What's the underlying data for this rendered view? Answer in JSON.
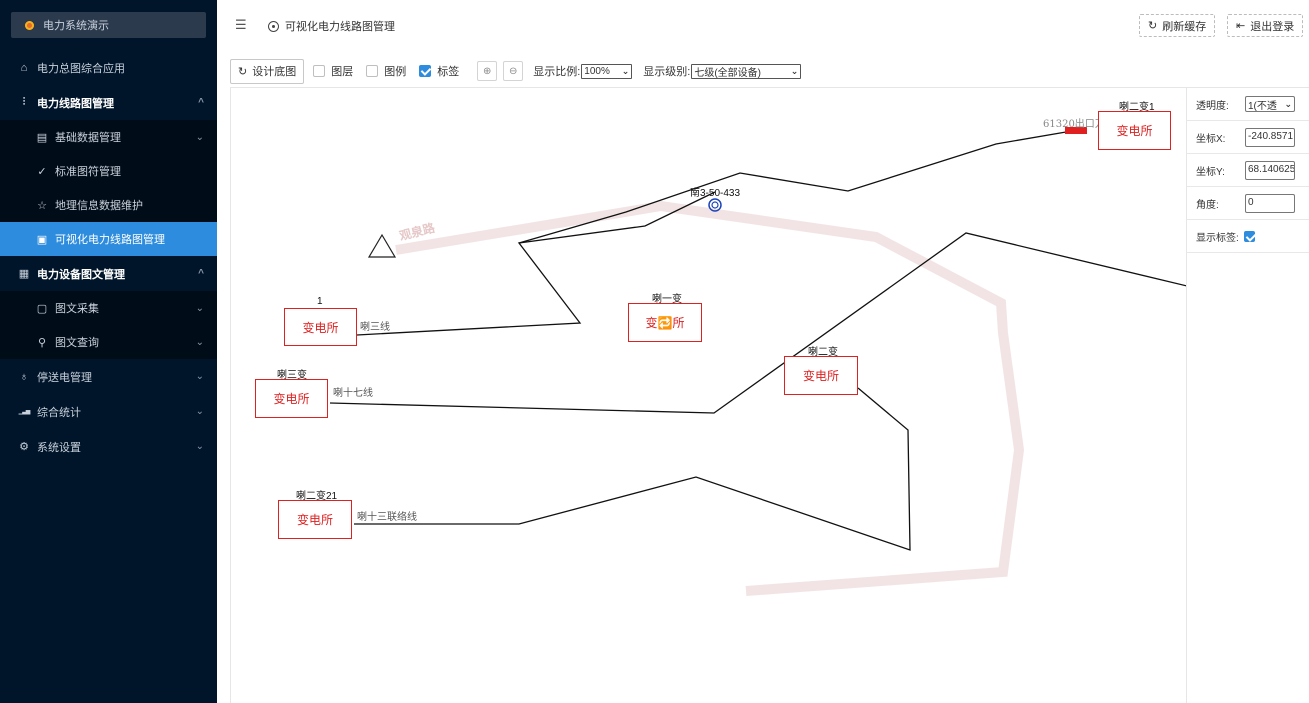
{
  "app": {
    "title": "电力系统演示"
  },
  "sidebar": {
    "items": [
      {
        "label": "电力总图综合应用",
        "icon": "home-icon",
        "glyph": "⌂"
      },
      {
        "label": "电力线路图管理",
        "icon": "signal-icon",
        "glyph": "⫶",
        "arrow": "^"
      },
      {
        "label": "基础数据管理",
        "icon": "document-icon",
        "glyph": "▤",
        "arrow": "⌄"
      },
      {
        "label": "标准图符管理",
        "icon": "check-icon",
        "glyph": "✓"
      },
      {
        "label": "地理信息数据维护",
        "icon": "star-icon",
        "glyph": "☆"
      },
      {
        "label": "可视化电力线路图管理",
        "icon": "grid-icon",
        "glyph": "▣"
      },
      {
        "label": "电力设备图文管理",
        "icon": "layout-icon",
        "glyph": "▦",
        "arrow": "^"
      },
      {
        "label": "图文采集",
        "icon": "file-icon",
        "glyph": "▢",
        "arrow": "⌄"
      },
      {
        "label": "图文查询",
        "icon": "search-icon",
        "glyph": "⚲",
        "arrow": "⌄"
      },
      {
        "label": "停送电管理",
        "icon": "location-icon",
        "glyph": "♁",
        "arrow": "⌄"
      },
      {
        "label": "综合统计",
        "icon": "chart-icon",
        "glyph": "▁▃▅",
        "arrow": "⌄"
      },
      {
        "label": "系统设置",
        "icon": "settings-icon",
        "glyph": "⚙",
        "arrow": "⌄"
      }
    ]
  },
  "header": {
    "menu_icon": "☰",
    "breadcrumb": "可视化电力线路图管理",
    "refresh_label": "刷新缓存",
    "refresh_icon": "↻",
    "logout_label": "退出登录",
    "logout_icon": "⇤"
  },
  "toolbar": {
    "design_label": "设计底图",
    "design_icon": "↻",
    "layer_label": "图层",
    "legend_label": "图例",
    "tag_label": "标签",
    "tag_checked": true,
    "zoom_in_icon": "⊕",
    "zoom_out_icon": "⊖",
    "scale_label": "显示比例:",
    "scale_value": "100%",
    "level_label": "显示级别:",
    "level_value": "七级(全部设备)"
  },
  "map": {
    "road_label": "观泉路",
    "pole_label": "南3-50-433",
    "switch_label": "61320出口刀闸",
    "stations": [
      {
        "name": "变电所",
        "label": "喇二变1"
      },
      {
        "name": "变电所",
        "label": "1"
      },
      {
        "name": "变🔁所",
        "label": "喇一变"
      },
      {
        "name": "变电所",
        "label": "喇三变"
      },
      {
        "name": "变电所",
        "label": "喇二变"
      },
      {
        "name": "变电所",
        "label": "喇二变21"
      }
    ],
    "lines": [
      "喇三线",
      "喇十七线",
      "喇十三联络线"
    ]
  },
  "props": {
    "opacity_label": "透明度:",
    "opacity_value": "1(不透",
    "x_label": "坐标X:",
    "x_value": "-240.8571",
    "y_label": "坐标Y:",
    "y_value": "68.140625",
    "angle_label": "角度:",
    "angle_value": "0",
    "show_tag_label": "显示标签:",
    "show_tag_checked": true
  },
  "colors": {
    "sidebar_bg": "#00152a",
    "active_bg": "#2d8cdd",
    "station": "#dd2222",
    "road": "#f2e4e4"
  }
}
